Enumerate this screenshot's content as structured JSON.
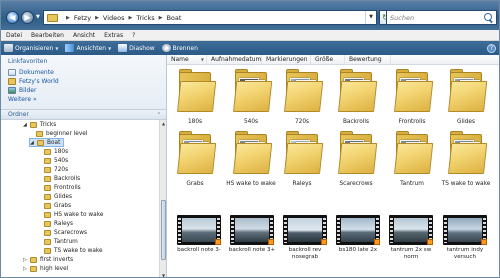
{
  "address": {
    "crumbs": [
      "Fetzy",
      "Videos",
      "Tricks",
      "Boat"
    ]
  },
  "search": {
    "placeholder": "Suchen"
  },
  "menu": [
    "Datei",
    "Bearbeiten",
    "Ansicht",
    "Extras",
    "?"
  ],
  "toolbar": {
    "organize": "Organisieren",
    "views": "Ansichten",
    "slideshow": "Diashow",
    "burn": "Brennen"
  },
  "favorites": {
    "title": "Linkfavoriten",
    "items": [
      "Dokumente",
      "Fetzy's World",
      "Bilder"
    ],
    "more": "Weitere"
  },
  "tree_header": "Ordner",
  "tree": [
    {
      "label": "Tricks",
      "indent": 0,
      "expander": "◢"
    },
    {
      "label": "beginner level",
      "indent": 1,
      "expander": ""
    },
    {
      "label": "Boat",
      "indent": 1,
      "expander": "◢",
      "selected": true
    },
    {
      "label": "180s",
      "indent": 2,
      "expander": ""
    },
    {
      "label": "540s",
      "indent": 2,
      "expander": ""
    },
    {
      "label": "720s",
      "indent": 2,
      "expander": ""
    },
    {
      "label": "Backrolls",
      "indent": 2,
      "expander": ""
    },
    {
      "label": "Frontrolls",
      "indent": 2,
      "expander": ""
    },
    {
      "label": "Glides",
      "indent": 2,
      "expander": ""
    },
    {
      "label": "Grabs",
      "indent": 2,
      "expander": ""
    },
    {
      "label": "HS wake to wake",
      "indent": 2,
      "expander": ""
    },
    {
      "label": "Raleys",
      "indent": 2,
      "expander": ""
    },
    {
      "label": "Scarecrows",
      "indent": 2,
      "expander": ""
    },
    {
      "label": "Tantrum",
      "indent": 2,
      "expander": ""
    },
    {
      "label": "TS wake to wake",
      "indent": 2,
      "expander": ""
    },
    {
      "label": "first inverts",
      "indent": 0,
      "expander": "▷"
    },
    {
      "label": "high level",
      "indent": 0,
      "expander": "▷"
    }
  ],
  "columns": [
    "Name",
    "Aufnahmedatum",
    "Markierungen",
    "Größe",
    "Bewertung"
  ],
  "folders": [
    "180s",
    "540s",
    "720s",
    "Backrolls",
    "Frontrolls",
    "Glides",
    "Grabs",
    "HS wake to wake",
    "Raleys",
    "Scarecrows",
    "Tantrum",
    "TS wake to wake"
  ],
  "videos": [
    "backroll note 3-",
    "backroll note 3+",
    "backroll rev\nnosegrab",
    "bs180 late 2x",
    "tantrum 2x sw norm",
    "tantrum indy\nversuch"
  ],
  "colors": {
    "toolbar": "#2f5e87",
    "link": "#1a55a0",
    "folder": "#e9c65c"
  }
}
